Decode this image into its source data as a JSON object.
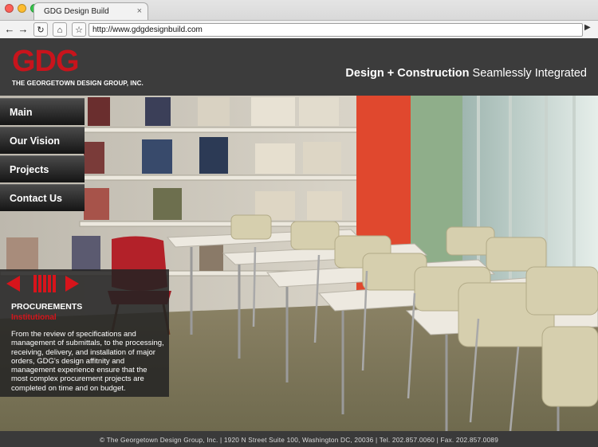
{
  "browser": {
    "tab_title": "GDG Design Build",
    "tab_close": "×",
    "url": "http://www.gdgdesignbuild.com",
    "traffic_lights": [
      "#fc5f57",
      "#fdbc2e",
      "#34c84a"
    ],
    "icons": {
      "back": "←",
      "forward": "→",
      "reload": "↻",
      "home": "⌂",
      "bookmark": "☆",
      "go": "▶"
    }
  },
  "header": {
    "logo": "GDG",
    "logo_subtitle": "THE GEORGETOWN DESIGN GROUP, INC.",
    "tagline_bold": "Design + Construction",
    "tagline_rest": " Seamlessly Integrated"
  },
  "nav": {
    "items": [
      {
        "label": "Main"
      },
      {
        "label": "Our Vision"
      },
      {
        "label": "Projects"
      },
      {
        "label": "Contact Us"
      }
    ]
  },
  "panel": {
    "title": "PROCUREMENTS",
    "subtitle": "Institutional",
    "body": "From the review of specifications and management of submittals, to the processing, receiving, delivery, and installation of major orders, GDG's design affitnity and management experience ensure that the most complex procurement projects are completed on time and on budget."
  },
  "footer": {
    "text": "© The Georgetown Design Group, Inc. | 1920 N Street Suite 100, Washington DC, 20036 | Tel. 202.857.0060 | Fax. 202.857.0089"
  },
  "colors": {
    "brand_red": "#c8141c",
    "accent_red": "#d7141b",
    "header_bg": "#3c3c3c"
  }
}
